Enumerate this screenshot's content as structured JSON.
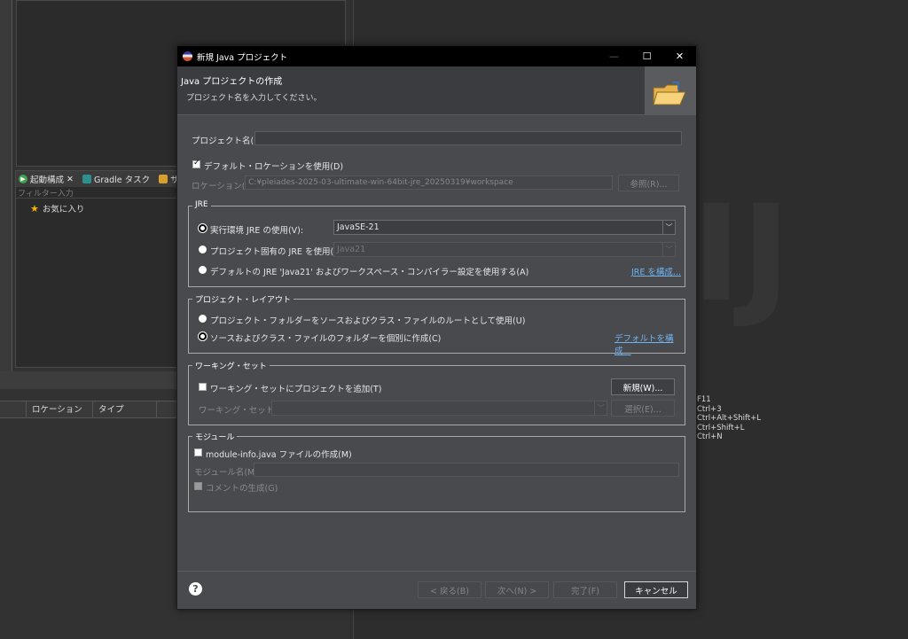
{
  "background": {
    "view_tabs": [
      {
        "label": "起動構成",
        "icon": "launch-config-icon"
      },
      {
        "label": "Gradle タスク",
        "icon": "gradle-icon"
      },
      {
        "label": "サ",
        "icon": "servers-icon"
      }
    ],
    "filter_placeholder": "フィルター入力",
    "favorites_label": "お気に入り",
    "table_columns": [
      "ロケーション",
      "タイプ"
    ],
    "shortcuts": [
      "F11",
      "Ctrl+3",
      "Ctrl+Alt+Shift+L",
      "Ctrl+Shift+L",
      "Ctrl+N"
    ],
    "watermark": "IJ"
  },
  "dialog": {
    "title": "新規 Java プロジェクト",
    "header_title": "Java プロジェクトの作成",
    "header_subtitle": "プロジェクト名を入力してください。",
    "project_name_label": "プロジェクト名(P):",
    "project_name_value": "",
    "default_location_label": "デフォルト・ロケーションを使用(D)",
    "default_location_checked": true,
    "location_label": "ロケーション(L):",
    "location_value": "C:¥pleiades-2025-03-ultimate-win-64bit-jre_20250319¥workspace",
    "browse_button": "参照(R)...",
    "jre_group": {
      "legend": "JRE",
      "option1_label": "実行環境 JRE の使用(V):",
      "option1_value": "JavaSE-21",
      "option2_label": "プロジェクト固有の JRE を使用(S):",
      "option2_value": "Java21",
      "option3_label": "デフォルトの JRE 'Java21' およびワークスペース・コンパイラー設定を使用する(A)",
      "configure_link": "JRE を構成..."
    },
    "layout_group": {
      "legend": "プロジェクト・レイアウト",
      "option1_label": "プロジェクト・フォルダーをソースおよびクラス・ファイルのルートとして使用(U)",
      "option2_label": "ソースおよびクラス・ファイルのフォルダーを個別に作成(C)",
      "configure_link": "デフォルトを構成..."
    },
    "working_set_group": {
      "legend": "ワーキング・セット",
      "add_label": "ワーキング・セットにプロジェクトを追加(T)",
      "new_button": "新規(W)...",
      "sets_label": "ワーキング・セット(O):",
      "select_button": "選択(E)..."
    },
    "module_group": {
      "legend": "モジュール",
      "create_label": "module-info.java ファイルの作成(M)",
      "module_name_label": "モジュール名(M):",
      "comment_label": "コメントの生成(G)"
    },
    "buttons": {
      "back": "< 戻る(B)",
      "next": "次へ(N) >",
      "finish": "完了(F)",
      "cancel": "キャンセル"
    },
    "help_icon": "?"
  }
}
